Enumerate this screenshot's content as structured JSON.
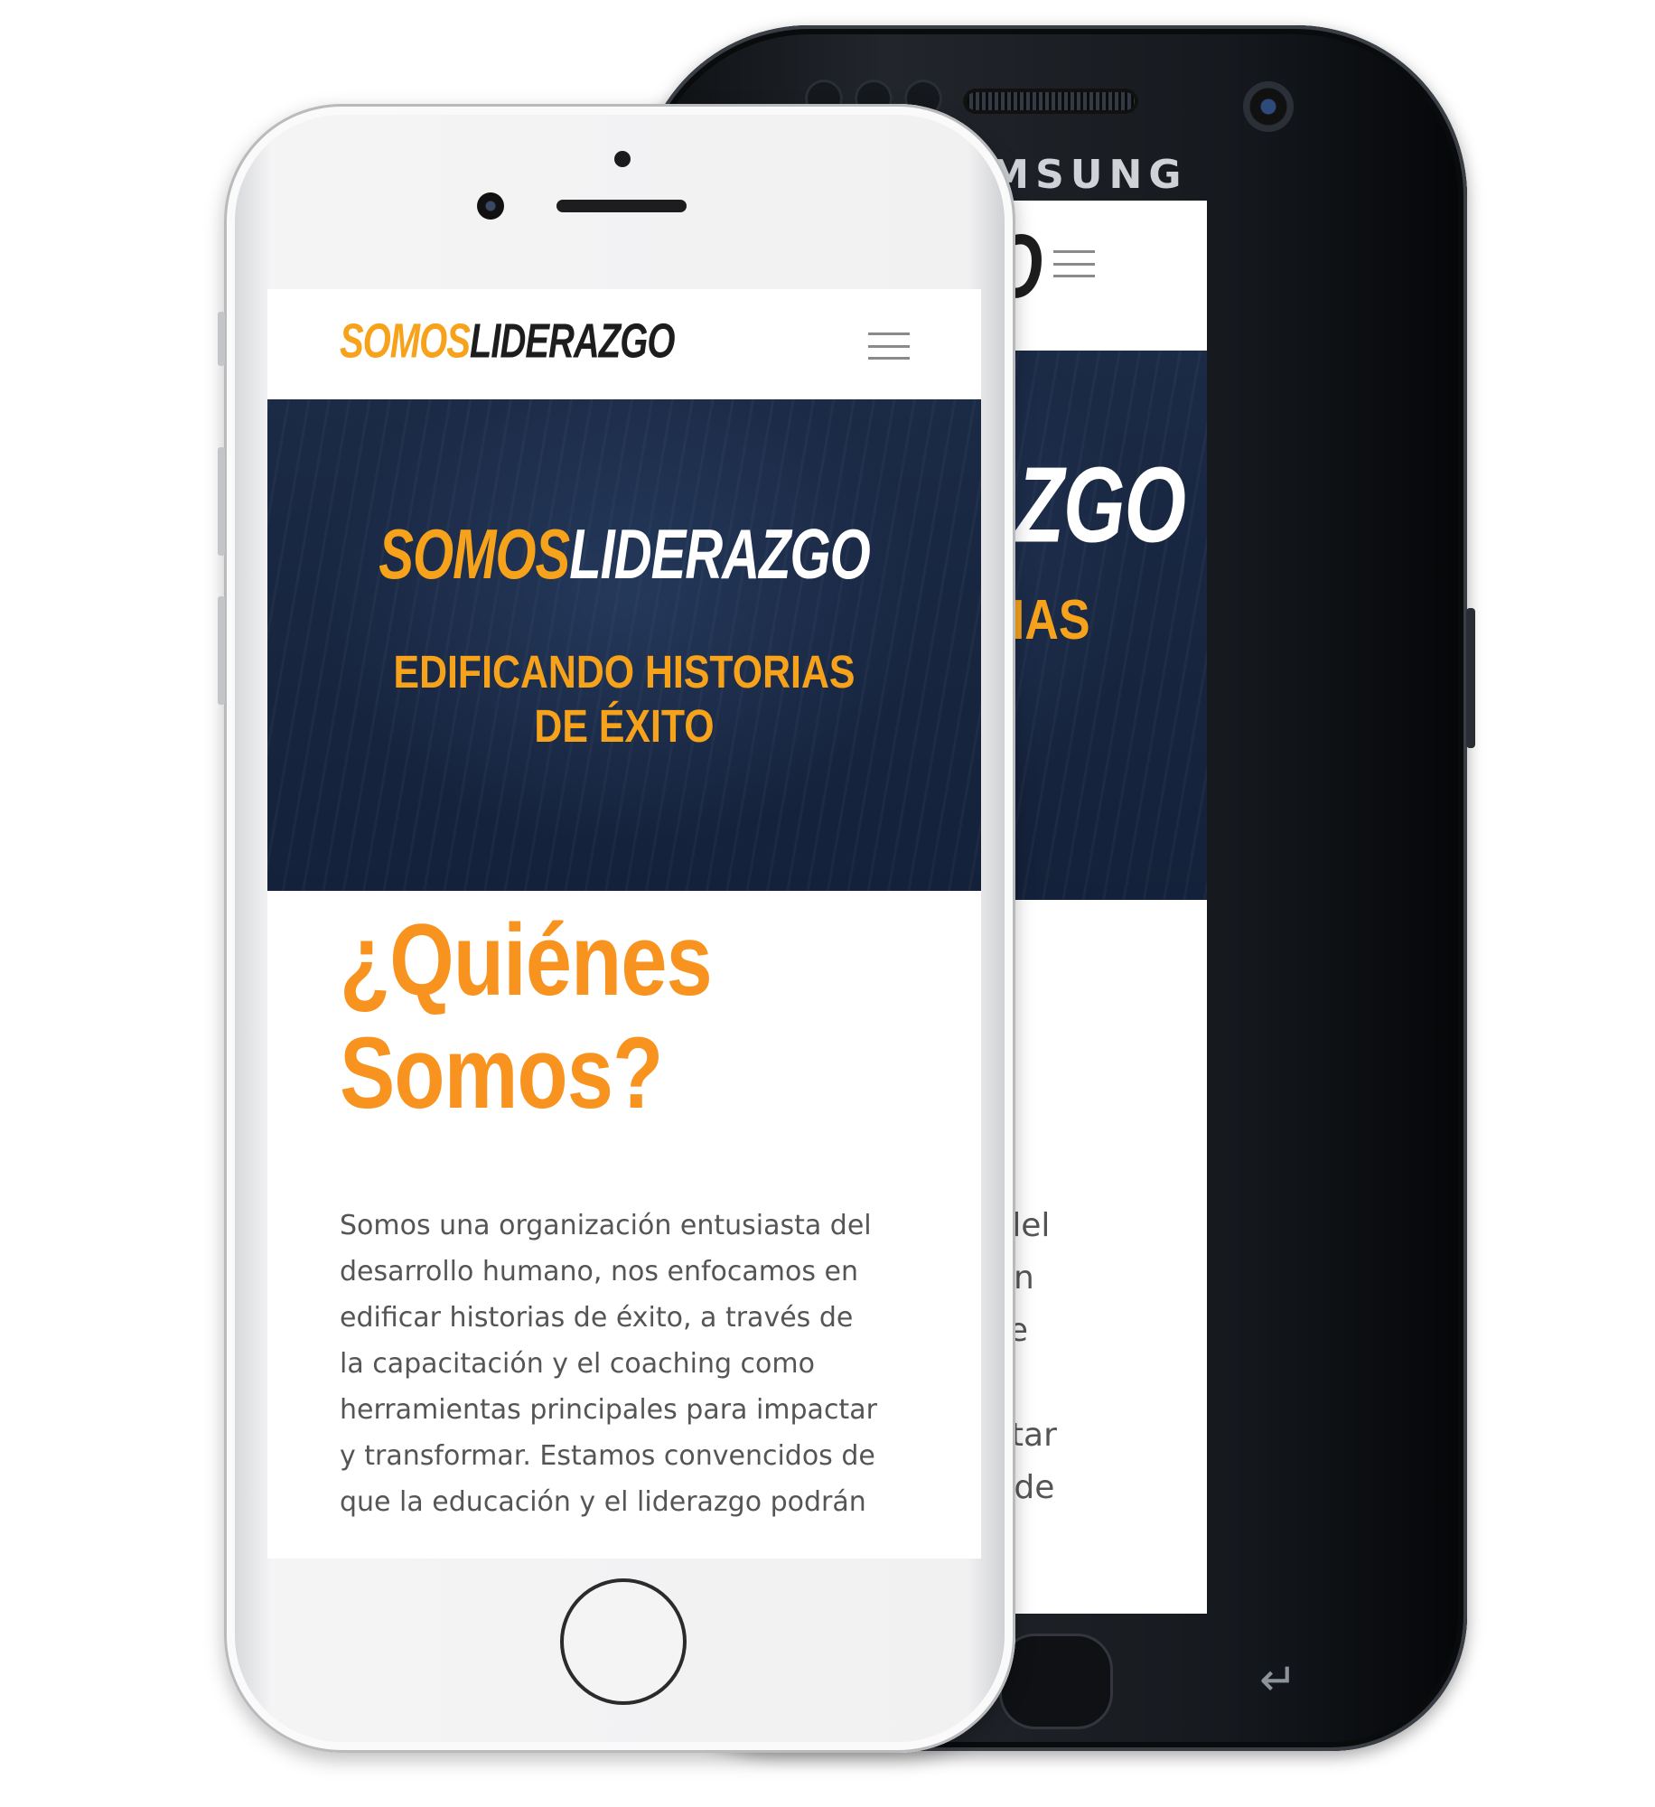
{
  "samsung": {
    "brand": "SAMSUNG",
    "back_icon": "back-arrow-icon"
  },
  "site": {
    "logo_part1": "SOMOS",
    "logo_part2": "LIDERAZGO",
    "menu_icon": "hamburger-menu-icon",
    "hero_tagline_line1": "EDIFICANDO HISTORIAS",
    "hero_tagline_line2": "DE ÉXITO",
    "heading_line1": "¿Quiénes",
    "heading_line2": "Somos?",
    "paragraph_lines": [
      "Somos una organización entusiasta del",
      "desarrollo humano, nos enfocamos en",
      "edificar historias de éxito, a través de",
      "la capacitación y el coaching como",
      "herramientas principales para impactar",
      "y transformar. Estamos convencidos de",
      "que la educación y el liderazgo podrán"
    ]
  },
  "colors": {
    "accent": "#f7931e",
    "hero_bg": "#172540",
    "text": "#555555"
  }
}
